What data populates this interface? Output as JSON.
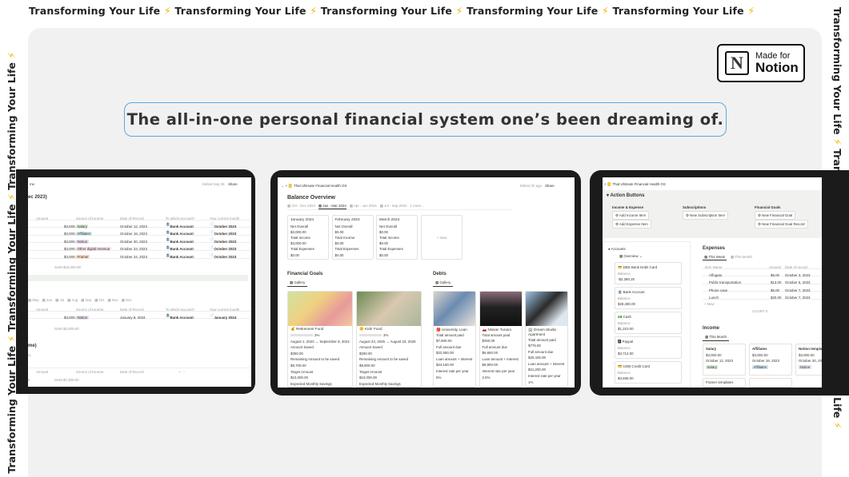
{
  "marquee": {
    "phrase": "Transforming Your Life",
    "separator": "⚡",
    "bolt_color": "#f5b400"
  },
  "badge": {
    "logo_letter": "N",
    "line1": "Made for",
    "line2": "Notion"
  },
  "headline": "The all-in-one personal financial system one’s been dreaming of.",
  "left_screen": {
    "breadcrumb": "me",
    "edited": "Edited Sep 26",
    "share": "Share",
    "section_title": "ec 2023)",
    "columns": [
      "Amount",
      "Source of Income",
      "Date of Record",
      "To which account?",
      "Your current month"
    ],
    "rows": [
      {
        "amount": "$3,000.00",
        "source": "Salary",
        "source_color": "#dbeddb",
        "date": "October 12, 2023",
        "account": "Bank Account",
        "month": "October 2023"
      },
      {
        "amount": "$3,000.00",
        "source": "Affiliates",
        "source_color": "#d3e5ef",
        "date": "October 19, 2023",
        "account": "Bank Account",
        "month": "October 2023"
      },
      {
        "amount": "$3,000.00",
        "source": "Notion",
        "source_color": "#e8deee",
        "date": "October 20, 2023",
        "account": "Bank Account",
        "month": "October 2023"
      },
      {
        "amount": "$3,000.00",
        "source": "Other digital revenue",
        "source_color": "#f5e0e9",
        "date": "October 23, 2023",
        "account": "Bank Account",
        "month": "October 2023"
      },
      {
        "amount": "$3,000.00",
        "source": "Framer",
        "source_color": "#fadec9",
        "date": "October 24, 2023",
        "account": "Bank Account",
        "month": "October 2023"
      }
    ],
    "sum1": "SUM $15,000.00",
    "month_tabs": [
      "May",
      "Jun",
      "Jul",
      "Aug",
      "Sep",
      "Oct",
      "Nov",
      "Dec"
    ],
    "row2": {
      "amount": "$3,000.00",
      "source": "Notion",
      "date": "January 8, 2024",
      "account": "Bank Account",
      "month": "January 2024"
    },
    "sum2": "SUM $3,000.00",
    "section2_title": "me)",
    "section2_sub": "ry",
    "columns2": [
      "Amount",
      "Source of Income",
      "Date of Record"
    ],
    "count3": "3",
    "sum3": "SUM $7,300.00"
  },
  "middle_screen": {
    "breadcrumb": "That Ultimate Financial Health OS",
    "edited": "Edited 2h ago",
    "share": "Share",
    "balance_title": "Balance Overview",
    "tabs": [
      "Oct - Dec 2023",
      "Jan - Mar 2024",
      "Apr - Jun 2024",
      "Jul - Sep 2024",
      "1 more..."
    ],
    "active_tab": 1,
    "months": [
      {
        "name": "January 2024",
        "net_label": "Net Overall",
        "net": "$3,000.00",
        "inc_label": "Total Income",
        "inc": "$3,000.00",
        "exp_label": "Total Expenses",
        "exp": "$0.00"
      },
      {
        "name": "February 2024",
        "net_label": "Net Overall",
        "net": "$0.00",
        "inc_label": "Total Income",
        "inc": "$0.00",
        "exp_label": "Total Expenses",
        "exp": "$0.00"
      },
      {
        "name": "March 2024",
        "net_label": "Net Overall",
        "net": "$0.00",
        "inc_label": "Total Income",
        "inc": "$0.00",
        "exp_label": "Total Expenses",
        "exp": "$0.00"
      }
    ],
    "new_label": "+ New",
    "goals_title": "Financial Goals",
    "gallery": "Gallery",
    "goals": [
      {
        "icon": "💰",
        "name": "Retirement Fund",
        "pct": "3%",
        "dates": "August 1, 2023 → September 8, 2024",
        "l1": "Amount Saved",
        "v1": "$300.00",
        "l2": "Remaining Amount to be saved",
        "v2": "$9,700.00",
        "l3": "Target Amount",
        "v3": "$10,000.00",
        "l4": "Expected Monthly Savings"
      },
      {
        "icon": "🌼",
        "name": "Kids' Fund",
        "pct": "3%",
        "dates": "August 23, 2025 → August 23, 2026",
        "l1": "Amount Saved",
        "v1": "$200.00",
        "l2": "Remaining Amount to be saved",
        "v2": "$9,800.00",
        "l3": "Target Amount",
        "v3": "$10,000.00",
        "l4": "Expected Monthly Savings"
      }
    ],
    "debts_title": "Debts",
    "debts": [
      {
        "icon": "🎒",
        "name": "University Loan",
        "l1": "Total amount paid",
        "v1": "$7,600.00",
        "l2": "Full amount due",
        "v2": "$22,550.00",
        "l3": "Loan amount + Interest",
        "v3": "$24,150.00",
        "l4": "Interest rate per year",
        "v4": "5%"
      },
      {
        "icon": "🚗",
        "name": "Nissan Tunaro",
        "l1": "Total amount paid",
        "v1": "$250.00",
        "l2": "Full amount due",
        "v2": "$6,650.00",
        "l3": "Loan amount + Interest",
        "v3": "$6,900.00",
        "l4": "Interest rate per year",
        "v4": "2.5%"
      },
      {
        "icon": "🏢",
        "name": "Dream Studio Apartment",
        "l1": "Total amount paid",
        "v1": "$775.00",
        "l2": "Full amount due",
        "v2": "$20,425.00",
        "l3": "Loan amount + Interest",
        "v3": "$21,200.00",
        "l4": "Interest rate per year",
        "v4": "1%"
      }
    ]
  },
  "right_screen": {
    "breadcrumb": "That Ultimate Financial Health OS",
    "action_title": "Action Buttons",
    "groups": [
      {
        "title": "Income & Expense",
        "buttons": [
          "Add Income Item",
          "Add Expense Item"
        ]
      },
      {
        "title": "Subscriptions",
        "buttons": [
          "New Subscription Item"
        ]
      },
      {
        "title": "Financial Goals",
        "buttons": [
          "New Financial Goal",
          "New Financial Goal Record"
        ]
      }
    ],
    "accounts_title": "Accounts",
    "overview": "Overview",
    "accounts": [
      {
        "icon": "💳",
        "name": "DBS Bank Debit Card",
        "label": "Balance",
        "value": "-$2,280.25"
      },
      {
        "icon": "🏦",
        "name": "Bank Account",
        "label": "Balance",
        "value": "$29,280.00"
      },
      {
        "icon": "💵",
        "name": "Cash",
        "label": "Balance",
        "value": "$1,210.00"
      },
      {
        "icon": "🅿",
        "name": "Paypal",
        "label": "Balance",
        "value": "$3,712.00"
      },
      {
        "icon": "💳",
        "name": "UOB Credit Card",
        "label": "Balance",
        "value": "$3,486.00"
      }
    ],
    "expenses_title": "Expenses",
    "exp_tabs": [
      "This Week",
      "This Month"
    ],
    "exp_columns": [
      "Item Name",
      "Amount",
      "Date of record"
    ],
    "expenses": [
      {
        "name": "Affogato",
        "amount": "$5.00",
        "date": "October 3, 2023"
      },
      {
        "name": "Public transportation",
        "amount": "$13.00",
        "date": "October 5, 2023"
      },
      {
        "name": "Phone case",
        "amount": "$5.00",
        "date": "October 7, 2023"
      },
      {
        "name": "Lunch",
        "amount": "$20.00",
        "date": "October 7, 2023"
      }
    ],
    "new_label": "+ New",
    "count": "COUNT 4",
    "income_title": "Income",
    "income_tab": "This Month",
    "income": [
      {
        "name": "Salary",
        "amount": "$3,000.00",
        "date": "October 12, 2023",
        "tag": "Salary",
        "tag_color": "#dbeddb"
      },
      {
        "name": "Affiliates",
        "amount": "$3,000.00",
        "date": "October 19, 2023",
        "tag": "Affiliates",
        "tag_color": "#d3e5ef"
      },
      {
        "name": "Notion templates",
        "amount": "$3,000.00",
        "date": "October 20, 2023",
        "tag": "Notion",
        "tag_color": "#e8deee"
      }
    ],
    "income_extra": "Framer templates"
  }
}
